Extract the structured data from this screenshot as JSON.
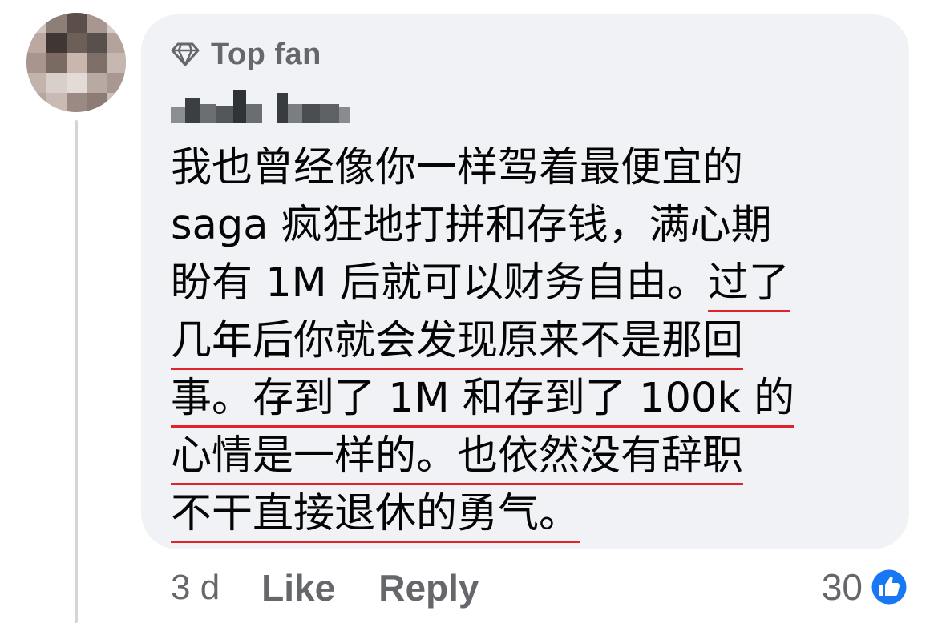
{
  "comment": {
    "badge": {
      "icon": "diamond-icon",
      "label": "Top fan"
    },
    "author": {
      "name_blurred": true
    },
    "body_lines": [
      "我也曾经像你一样驾着最便宜的",
      "saga 疯狂地打拼和存钱，满心期",
      "盼有 1M 后就可以财务自由。",
      "过了",
      "几年后你就会发现原来不是那回",
      "事。存到了 1M 和存到了 100k 的",
      "心情是一样的。也依然没有辞职",
      "不干直接退休的勇气。"
    ],
    "annotation_color": "#e0242b",
    "actions": {
      "timestamp": "3 d",
      "like_label": "Like",
      "reply_label": "Reply"
    },
    "reactions": {
      "count": "30",
      "icon": "thumbs-up-icon",
      "icon_color": "#1877f2"
    }
  }
}
